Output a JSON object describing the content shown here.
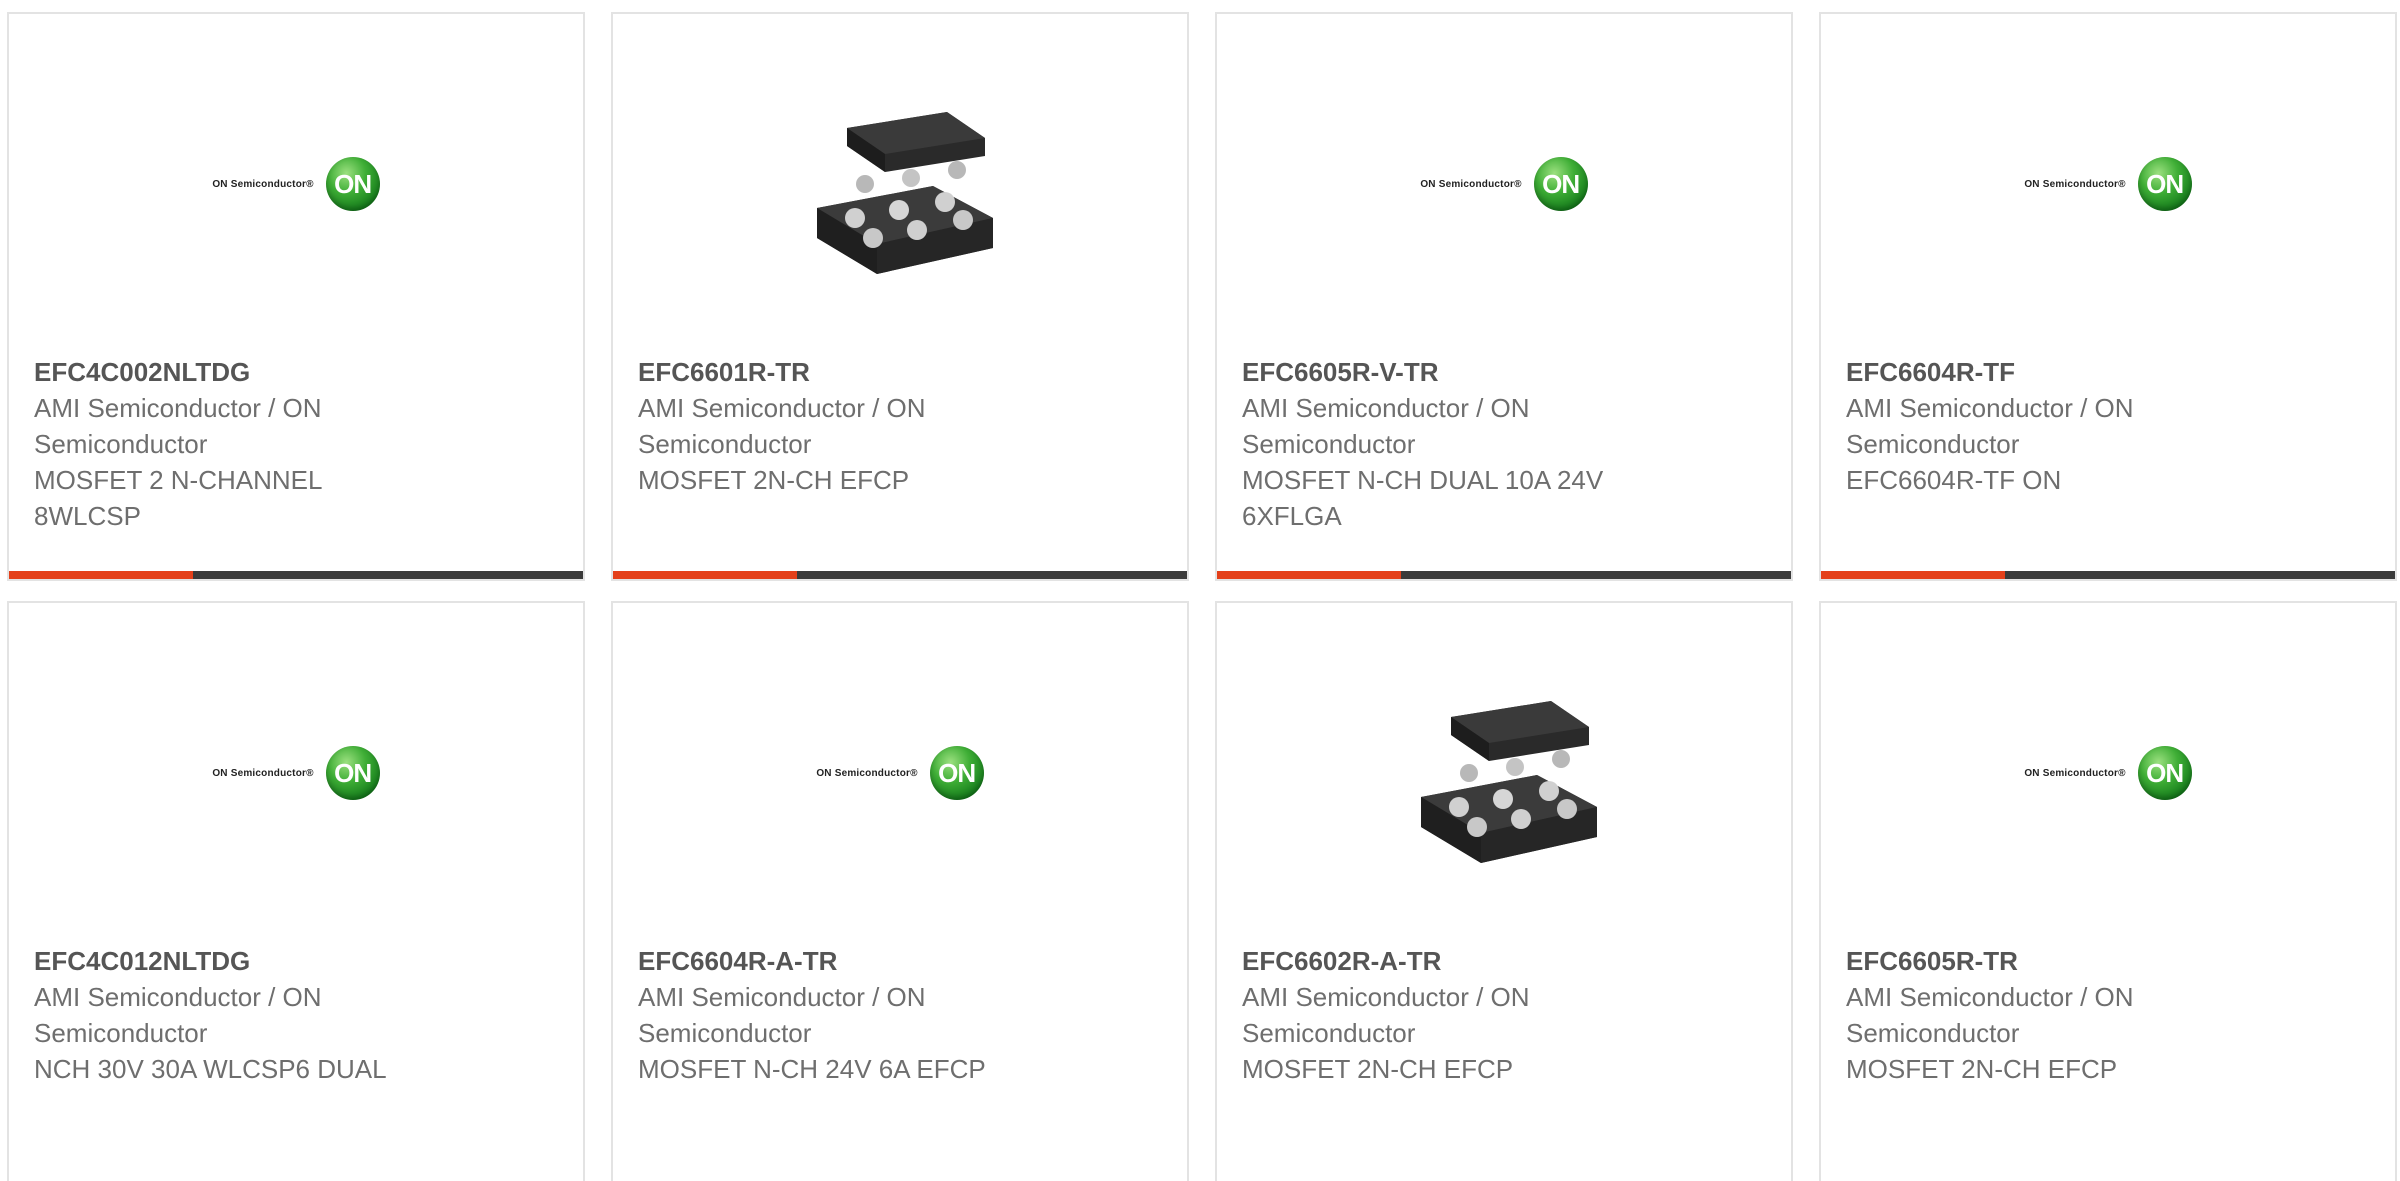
{
  "colors": {
    "accent": "#e4401a",
    "bar_track": "#3a3a3a",
    "on_logo_green": "#2e9a2c"
  },
  "logo": {
    "text": "ON Semiconductor®",
    "mark": "ON"
  },
  "products": [
    {
      "part_number": "EFC4C002NLTDG",
      "manufacturer": "AMI Semiconductor / ON Semiconductor",
      "description": "MOSFET 2 N-CHANNEL 8WLCSP",
      "image": "on-semiconductor-logo",
      "progress": 0.32
    },
    {
      "part_number": "EFC6601R-TR",
      "manufacturer": "AMI Semiconductor / ON Semiconductor",
      "description": "MOSFET 2N-CH EFCP",
      "image": "chip-package",
      "progress": 0.32
    },
    {
      "part_number": "EFC6605R-V-TR",
      "manufacturer": "AMI Semiconductor / ON Semiconductor",
      "description": "MOSFET N-CH DUAL 10A 24V 6XFLGA",
      "image": "on-semiconductor-logo",
      "progress": 0.32
    },
    {
      "part_number": "EFC6604R-TF",
      "manufacturer": "AMI Semiconductor / ON Semiconductor",
      "description": "EFC6604R-TF ON",
      "image": "on-semiconductor-logo",
      "progress": 0.32
    },
    {
      "part_number": "EFC4C012NLTDG",
      "manufacturer": "AMI Semiconductor / ON Semiconductor",
      "description": "NCH 30V 30A WLCSP6 DUAL",
      "image": "on-semiconductor-logo"
    },
    {
      "part_number": "EFC6604R-A-TR",
      "manufacturer": "AMI Semiconductor / ON Semiconductor",
      "description": "MOSFET N-CH 24V 6A EFCP",
      "image": "on-semiconductor-logo"
    },
    {
      "part_number": "EFC6602R-A-TR",
      "manufacturer": "AMI Semiconductor / ON Semiconductor",
      "description": "MOSFET 2N-CH EFCP",
      "image": "chip-package"
    },
    {
      "part_number": "EFC6605R-TR",
      "manufacturer": "AMI Semiconductor / ON Semiconductor",
      "description": "MOSFET 2N-CH EFCP",
      "image": "on-semiconductor-logo"
    }
  ]
}
